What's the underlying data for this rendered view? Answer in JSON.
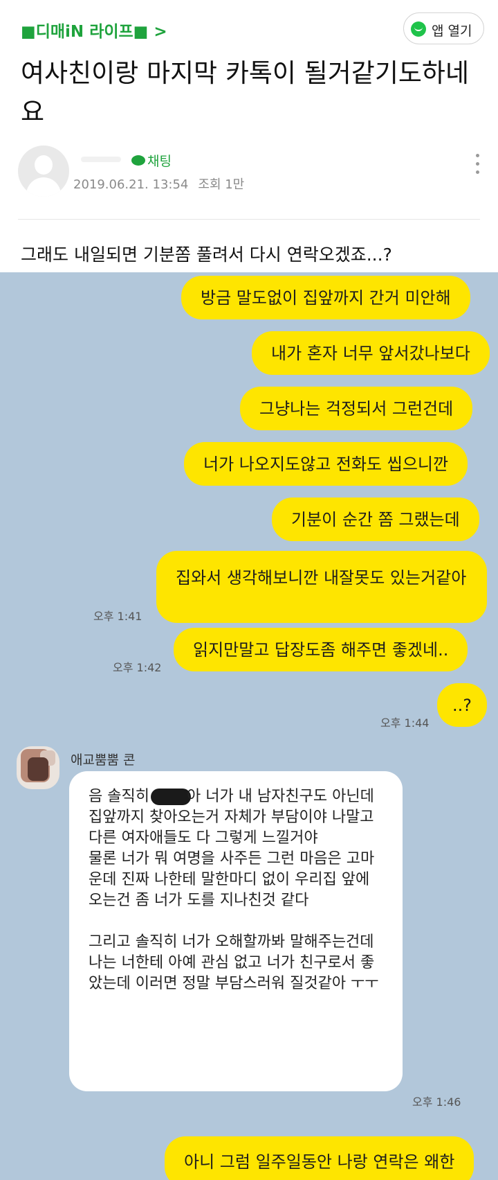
{
  "header": {
    "cafe_name": "■디매iN 라이프■ >",
    "open_app_label": "앱 열기"
  },
  "post": {
    "title": "여사친이랑 마지막 카톡이 될거같기도하네요",
    "board": "채팅",
    "date": "2019.06.21. 13:54",
    "views": "조회 1만",
    "body": "그래도 내일되면 기분쫌 풀려서 다시 연락오겠죠...?"
  },
  "chat": {
    "background": "#b2c7da",
    "sent_color": "#fee500",
    "sent": [
      {
        "text": "방금 말도없이 집앞까지 간거 미안해"
      },
      {
        "text": "내가 혼자 너무 앞서갔나보다"
      },
      {
        "text": "그냥나는 걱정되서 그런건데"
      },
      {
        "text": "너가 나오지도않고 전화도 씹으니깐"
      },
      {
        "text": "기분이 순간 쫌 그랬는데"
      },
      {
        "text": "집와서 생각해보니깐 내잘못도 있는거같아",
        "time": "오후 1:41"
      },
      {
        "text": "읽지만말고 답장도좀 해주면 좋겠네..",
        "time": "오후 1:42"
      },
      {
        "text": "..?",
        "time": "오후 1:44"
      }
    ],
    "received": {
      "sender": "애교뿜뿜 콘",
      "prefix": "음 솔직히",
      "paragraph1": "아 너가 내 남자친구도 아닌데 집앞까지 찾아오는거 자체가 부담이야 나말고 다른 여자애들도 다 그렇게 느낄거야",
      "paragraph2": "물론 너가 뭐 여명을 사주든 그런 마음은 고마운데 진짜 나한테 말한마디 없이 우리집 앞에 오는건 좀 너가 도를 지나친것 같다",
      "paragraph3": "그리고 솔직히 너가 오해할까봐 말해주는건데 나는 너한테 아예 관심 없고 너가 친구로서 좋았는데 이러면 정말 부담스러워 질것같아 ㅜㅜ",
      "time": "오후 1:46"
    },
    "last_sent": {
      "text": "아니 그럼 일주일동안 나랑 연락은 왜한"
    }
  }
}
